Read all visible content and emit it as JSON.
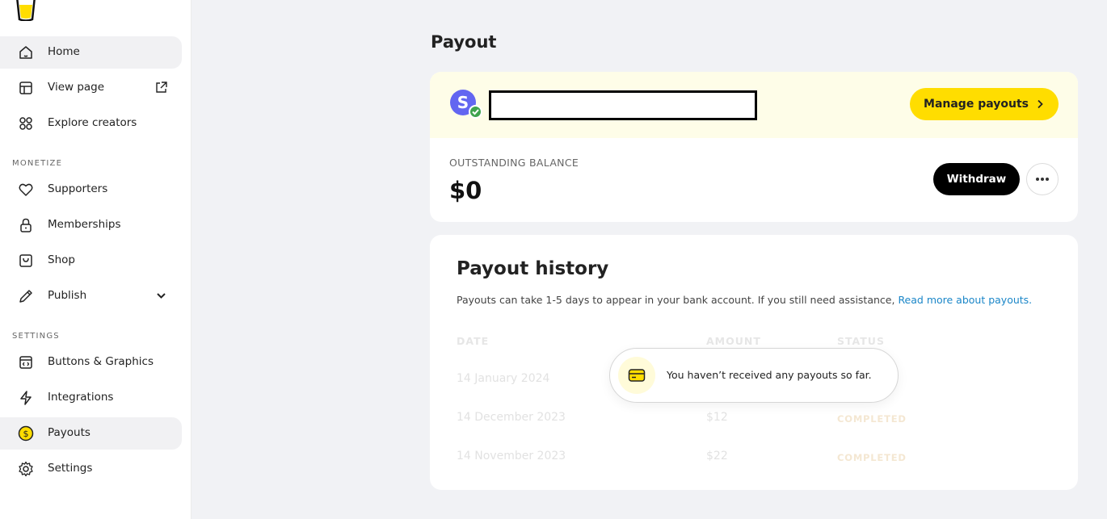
{
  "sidebar": {
    "items": [
      {
        "label": "Home",
        "icon": "home-icon",
        "active": true
      },
      {
        "label": "View page",
        "icon": "layout-icon"
      },
      {
        "label": "Explore creators",
        "icon": "grid-icon"
      },
      {
        "label": "Supporters",
        "icon": "heart-icon"
      },
      {
        "label": "Memberships",
        "icon": "lock-icon"
      },
      {
        "label": "Shop",
        "icon": "bag-icon"
      },
      {
        "label": "Publish",
        "icon": "pencil-icon"
      },
      {
        "label": "Buttons & Graphics",
        "icon": "code-window-icon"
      },
      {
        "label": "Integrations",
        "icon": "bolt-icon"
      },
      {
        "label": "Payouts",
        "icon": "dollar-coin-icon",
        "active": true
      },
      {
        "label": "Settings",
        "icon": "gear-icon"
      }
    ],
    "sections": {
      "monetize": "MONETIZE",
      "settings": "SETTINGS"
    }
  },
  "main": {
    "title": "Payout",
    "account": {
      "avatar_letter": "S",
      "manage_label": "Manage payouts"
    },
    "balance": {
      "label": "OUTSTANDING BALANCE",
      "value": "$0",
      "withdraw_label": "Withdraw"
    },
    "history": {
      "title": "Payout history",
      "description": "Payouts can take 1-5 days to appear in your bank account. If you still need assistance, ",
      "link_text": "Read more about payouts.",
      "columns": [
        "DATE",
        "AMOUNT",
        "STATUS"
      ],
      "rows": [
        {
          "date": "14 January 2024",
          "amount": "",
          "status": ""
        },
        {
          "date": "14 December 2023",
          "amount": "$12",
          "status": "COMPLETED"
        },
        {
          "date": "14 November 2023",
          "amount": "$22",
          "status": "COMPLETED"
        }
      ]
    },
    "empty_toast": {
      "text": "You haven’t received any payouts so far.",
      "icon": "card-icon"
    }
  },
  "colors": {
    "accent_yellow": "#ffdd00",
    "avatar_purple": "#6366f1",
    "verified_green": "#3fa34d",
    "link_blue": "#1a86c8",
    "banner_bg": "#fefde8"
  }
}
